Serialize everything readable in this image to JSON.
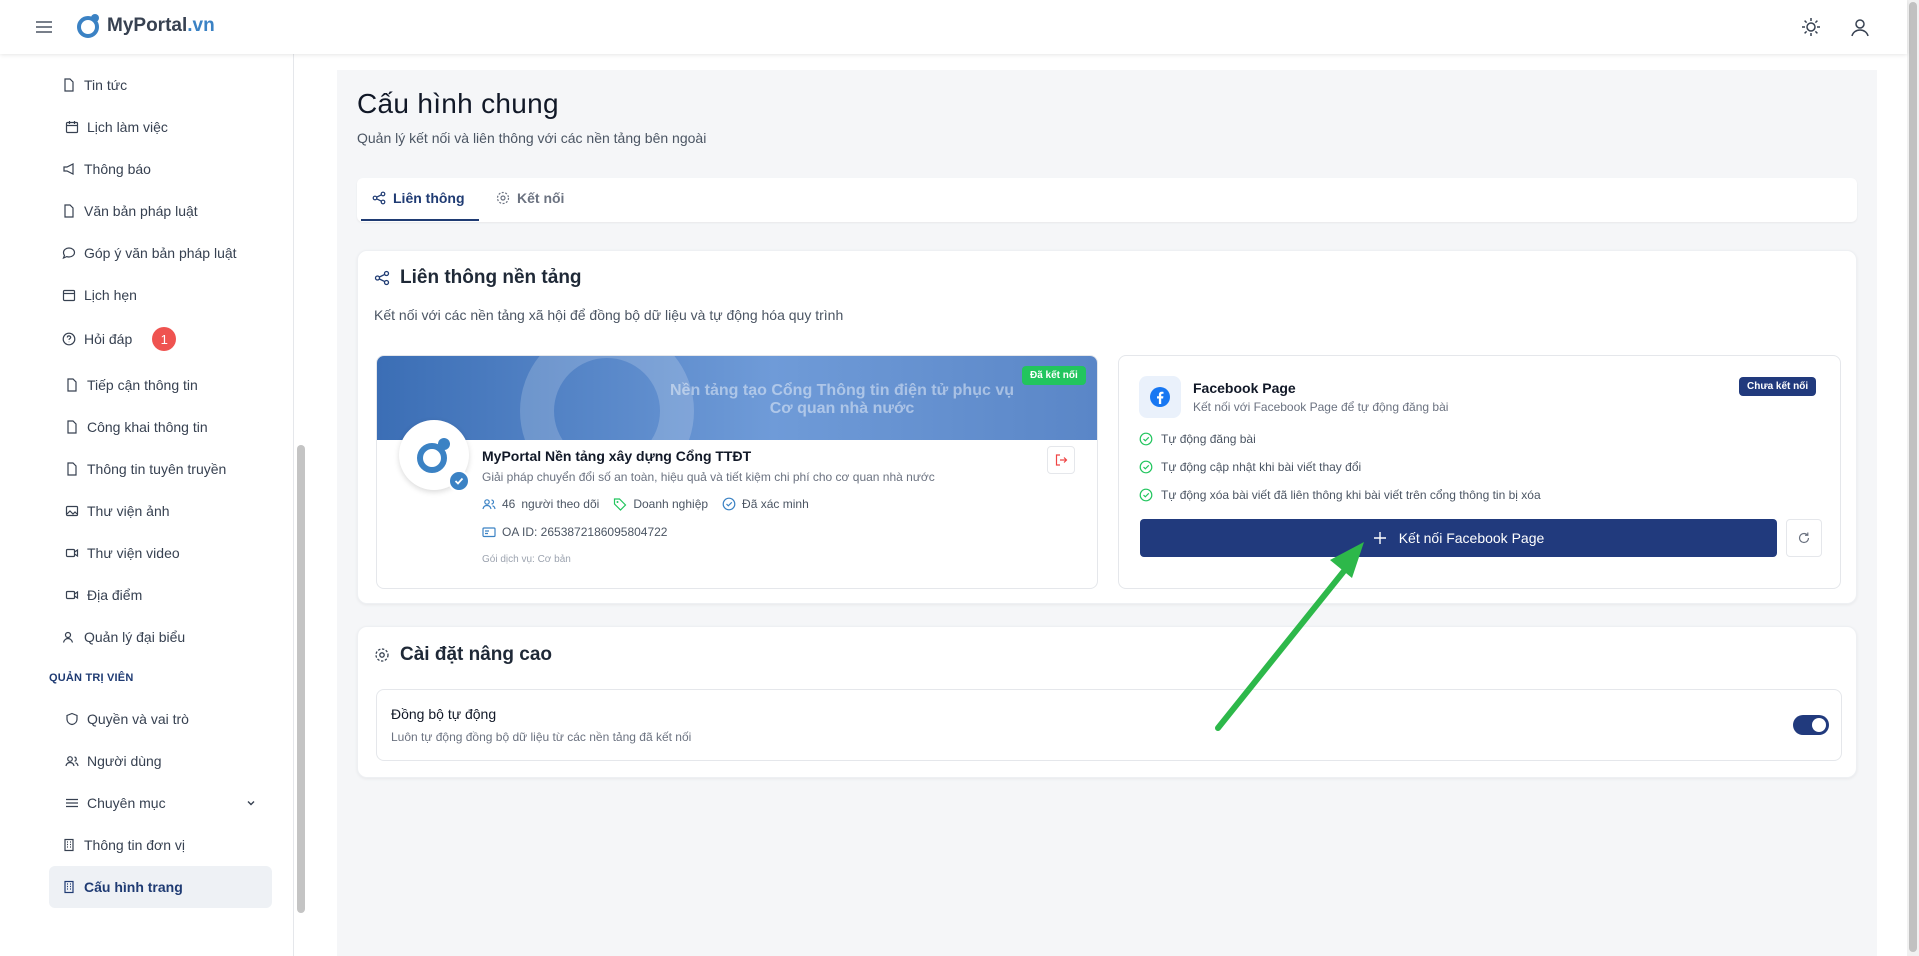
{
  "header": {
    "logo_main": "MyPortal",
    "logo_tld": ".vn"
  },
  "sidebar": {
    "items": [
      {
        "label": "Tin tức",
        "icon": "file-icon"
      },
      {
        "label": "Lịch làm việc",
        "icon": "calendar-icon"
      },
      {
        "label": "Thông báo",
        "icon": "megaphone-icon"
      },
      {
        "label": "Văn bản pháp luật",
        "icon": "file-icon"
      },
      {
        "label": "Góp ý văn bản pháp luật",
        "icon": "chat-icon"
      },
      {
        "label": "Lịch hẹn",
        "icon": "calendar-icon"
      },
      {
        "label": "Hỏi đáp",
        "icon": "help-icon",
        "badge": "1"
      },
      {
        "label": "Tiếp cận thông tin",
        "icon": "file-icon"
      },
      {
        "label": "Công khai thông tin",
        "icon": "file-icon"
      },
      {
        "label": "Thông tin tuyên truyền",
        "icon": "file-icon"
      },
      {
        "label": "Thư viện ảnh",
        "icon": "image-icon"
      },
      {
        "label": "Thư viện video",
        "icon": "video-icon"
      },
      {
        "label": "Địa điểm",
        "icon": "video-icon"
      },
      {
        "label": "Quản lý đại biểu",
        "icon": "user-icon"
      }
    ],
    "section_admin": "QUẢN TRỊ VIÊN",
    "admin_items": [
      {
        "label": "Quyền và vai trò",
        "icon": "shield-icon"
      },
      {
        "label": "Người dùng",
        "icon": "users-icon"
      },
      {
        "label": "Chuyên mục",
        "icon": "list-icon"
      },
      {
        "label": "Thông tin đơn vị",
        "icon": "building-icon"
      },
      {
        "label": "Cấu hình trang",
        "icon": "building-icon",
        "active": true
      }
    ]
  },
  "page": {
    "title": "Cấu hình chung",
    "subtitle": "Quản lý kết nối và liên thông với các nền tảng bên ngoài"
  },
  "tabs": [
    {
      "label": "Liên thông",
      "active": true
    },
    {
      "label": "Kết nối",
      "active": false
    }
  ],
  "integration": {
    "title": "Liên thông nền tảng",
    "description": "Kết nối với các nền tảng xã hội để đồng bộ dữ liệu và tự động hóa quy trình",
    "zalo": {
      "banner_text": "Nền tảng tạo Cổng Thông tin điện tử phục vụ Cơ quan nhà nước",
      "status": "Đã kết nối",
      "name": "MyPortal Nền tảng xây dựng Cổng TTĐT",
      "description": "Giải pháp chuyển đổi số an toàn, hiệu quả và tiết kiệm chi phí cho cơ quan nhà nước",
      "followers": "46",
      "followers_label": "người theo dõi",
      "category": "Doanh nghiệp",
      "verified": "Đã xác minh",
      "oa_id": "OA ID: 2653872186095804722",
      "plan": "Gói dịch vụ: Cơ bản"
    },
    "facebook": {
      "name": "Facebook Page",
      "description": "Kết nối với Facebook Page để tự động đăng bài",
      "status": "Chưa kết nối",
      "features": [
        "Tự động đăng bài",
        "Tự động cập nhật khi bài viết thay đổi",
        "Tự động xóa bài viết đã liên thông khi bài viết trên cổng thông tin bị xóa"
      ],
      "connect_label": "Kết nối Facebook Page"
    }
  },
  "advanced": {
    "title": "Cài đặt nâng cao",
    "auto_sync_label": "Đồng bộ tự động",
    "auto_sync_desc": "Luôn tự động đồng bộ dữ liệu từ các nền tảng đã kết nối",
    "auto_sync_enabled": true
  },
  "colors": {
    "primary": "#213a7d",
    "success": "#22c55e",
    "danger": "#ef5350",
    "annotation_arrow": "#2db84a"
  }
}
